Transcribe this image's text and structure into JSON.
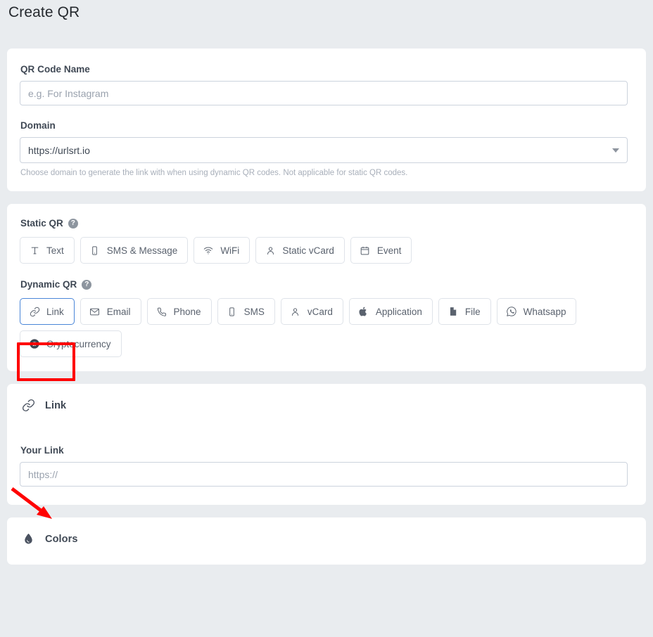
{
  "page": {
    "title": "Create QR",
    "background_color": "#e9ecef",
    "card_color": "#ffffff"
  },
  "basics": {
    "qr_name": {
      "label": "QR Code Name",
      "value": "",
      "placeholder": "e.g. For Instagram"
    },
    "domain": {
      "label": "Domain",
      "selected": "https://urlsrt.io",
      "help": "Choose domain to generate the link with when using dynamic QR codes. Not applicable for static QR codes.",
      "arrow_icon": "chevron-down-icon"
    }
  },
  "types": {
    "static": {
      "label": "Static QR",
      "help_icon": "question-mark-icon",
      "items": [
        {
          "label": "Text",
          "icon": "text-icon",
          "selected": false
        },
        {
          "label": "SMS & Message",
          "icon": "mobile-icon",
          "selected": false
        },
        {
          "label": "WiFi",
          "icon": "wifi-icon",
          "selected": false
        },
        {
          "label": "Static vCard",
          "icon": "person-icon",
          "selected": false
        },
        {
          "label": "Event",
          "icon": "calendar-icon",
          "selected": false
        }
      ]
    },
    "dynamic": {
      "label": "Dynamic QR",
      "help_icon": "question-mark-icon",
      "items": [
        {
          "label": "Link",
          "icon": "link-icon",
          "selected": true
        },
        {
          "label": "Email",
          "icon": "envelope-icon",
          "selected": false
        },
        {
          "label": "Phone",
          "icon": "phone-icon",
          "selected": false
        },
        {
          "label": "SMS",
          "icon": "mobile-icon",
          "selected": false
        },
        {
          "label": "vCard",
          "icon": "person-icon",
          "selected": false
        },
        {
          "label": "Application",
          "icon": "apple-icon",
          "selected": false
        },
        {
          "label": "File",
          "icon": "file-icon",
          "selected": false
        },
        {
          "label": "Whatsapp",
          "icon": "whatsapp-icon",
          "selected": false
        },
        {
          "label": "Cryptocurrency",
          "icon": "bitcoin-icon",
          "selected": false
        }
      ]
    },
    "selected_border_color": "#4a86d8"
  },
  "link_section": {
    "heading": "Link",
    "heading_icon": "link-icon",
    "your_link": {
      "label": "Your Link",
      "value": "",
      "placeholder": "https://"
    }
  },
  "colors_section": {
    "heading": "Colors",
    "heading_icon": "droplet-icon"
  },
  "annotations": {
    "color": "#ff0000",
    "highlight_box": "link-type-button",
    "arrow_points_to": "your-link-label"
  }
}
